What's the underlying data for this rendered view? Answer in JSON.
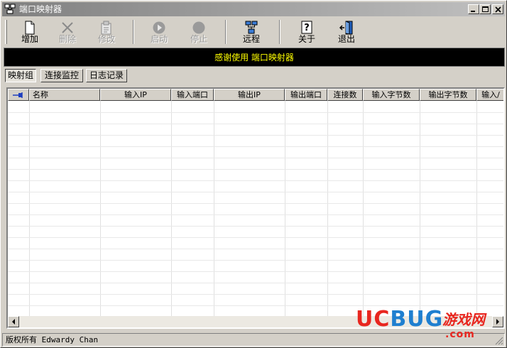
{
  "window": {
    "title": "端口映射器"
  },
  "toolbar": {
    "buttons": [
      {
        "label": "增加",
        "icon": "document-icon",
        "enabled": true
      },
      {
        "label": "删除",
        "icon": "x-icon",
        "enabled": false
      },
      {
        "label": "修改",
        "icon": "edit-icon",
        "enabled": false
      },
      {
        "label": "启动",
        "icon": "play-icon",
        "enabled": false
      },
      {
        "label": "停止",
        "icon": "stop-icon",
        "enabled": false
      },
      {
        "label": "远程",
        "icon": "network-icon",
        "enabled": true
      },
      {
        "label": "关于",
        "icon": "help-icon",
        "enabled": true
      },
      {
        "label": "退出",
        "icon": "exit-door-icon",
        "enabled": true
      }
    ]
  },
  "banner": {
    "text": "感谢使用 端口映射器",
    "color": "#ffff00",
    "background": "#000000"
  },
  "tabs": [
    {
      "label": "映射组",
      "active": true
    },
    {
      "label": "连接监控",
      "active": false
    },
    {
      "label": "日志记录",
      "active": false
    }
  ],
  "table": {
    "columns": [
      "名称",
      "输入IP",
      "输入端口",
      "输出IP",
      "输出端口",
      "连接数",
      "输入字节数",
      "输出字节数",
      "输入/"
    ],
    "rows": []
  },
  "status": {
    "text": "版权所有 Edwardy Chan"
  },
  "watermark": {
    "brand_uc": "UC",
    "brand_bug": "BUG",
    "cn": "游戏网",
    "com": ".com"
  }
}
